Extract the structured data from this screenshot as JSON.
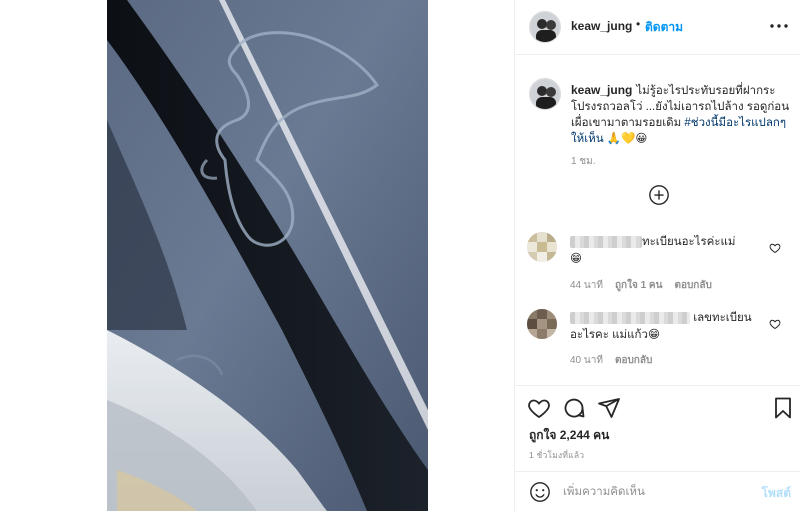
{
  "post": {
    "image_alt": "",
    "author": "keaw_jung",
    "separator": "•",
    "follow_label": "ติดตาม",
    "caption_text": "ไม่รู้อะไรประทับรอยที่ฝากระโปรงรถวอลโว่ ...ยังไม่เอารถไปล้าง รอดูก่อน เผื่อเขามาตามรอยเดิม",
    "caption_hashtag": "#ช่วงนี้มีอะไรแปลกๆให้เห็น",
    "caption_emojis": "🙏💛😀",
    "caption_time": "1 ชม.",
    "likes_text": "ถูกใจ 2,244 คน",
    "post_time": "1 ชั่วโมงที่แล้ว"
  },
  "comments": [
    {
      "text": "ทะเบียนอะไรค่ะแม่",
      "emoji": "😁",
      "time": "44 นาที",
      "likes": "ถูกใจ 1 คน",
      "reply": "ตอบกลับ"
    },
    {
      "text": "เลขทะเบียน",
      "text2": "อะไรคะ แม่แก้ว",
      "emoji": "😁",
      "time": "40 นาที",
      "reply": "ตอบกลับ"
    }
  ],
  "composer": {
    "placeholder": "เพิ่มความคิดเห็น",
    "post_label": "โพสต์"
  },
  "icons": {
    "more": "more-horizontal-icon",
    "load_more": "plus-circle-icon",
    "like": "heart-icon",
    "comment": "comment-icon",
    "share": "paper-plane-icon",
    "save": "bookmark-icon",
    "emoji": "smiley-icon"
  },
  "colors": {
    "accent": "#0095f6",
    "hashtag": "#00376b",
    "muted": "#8e8e8e",
    "post_disabled": "#b2dffc"
  }
}
